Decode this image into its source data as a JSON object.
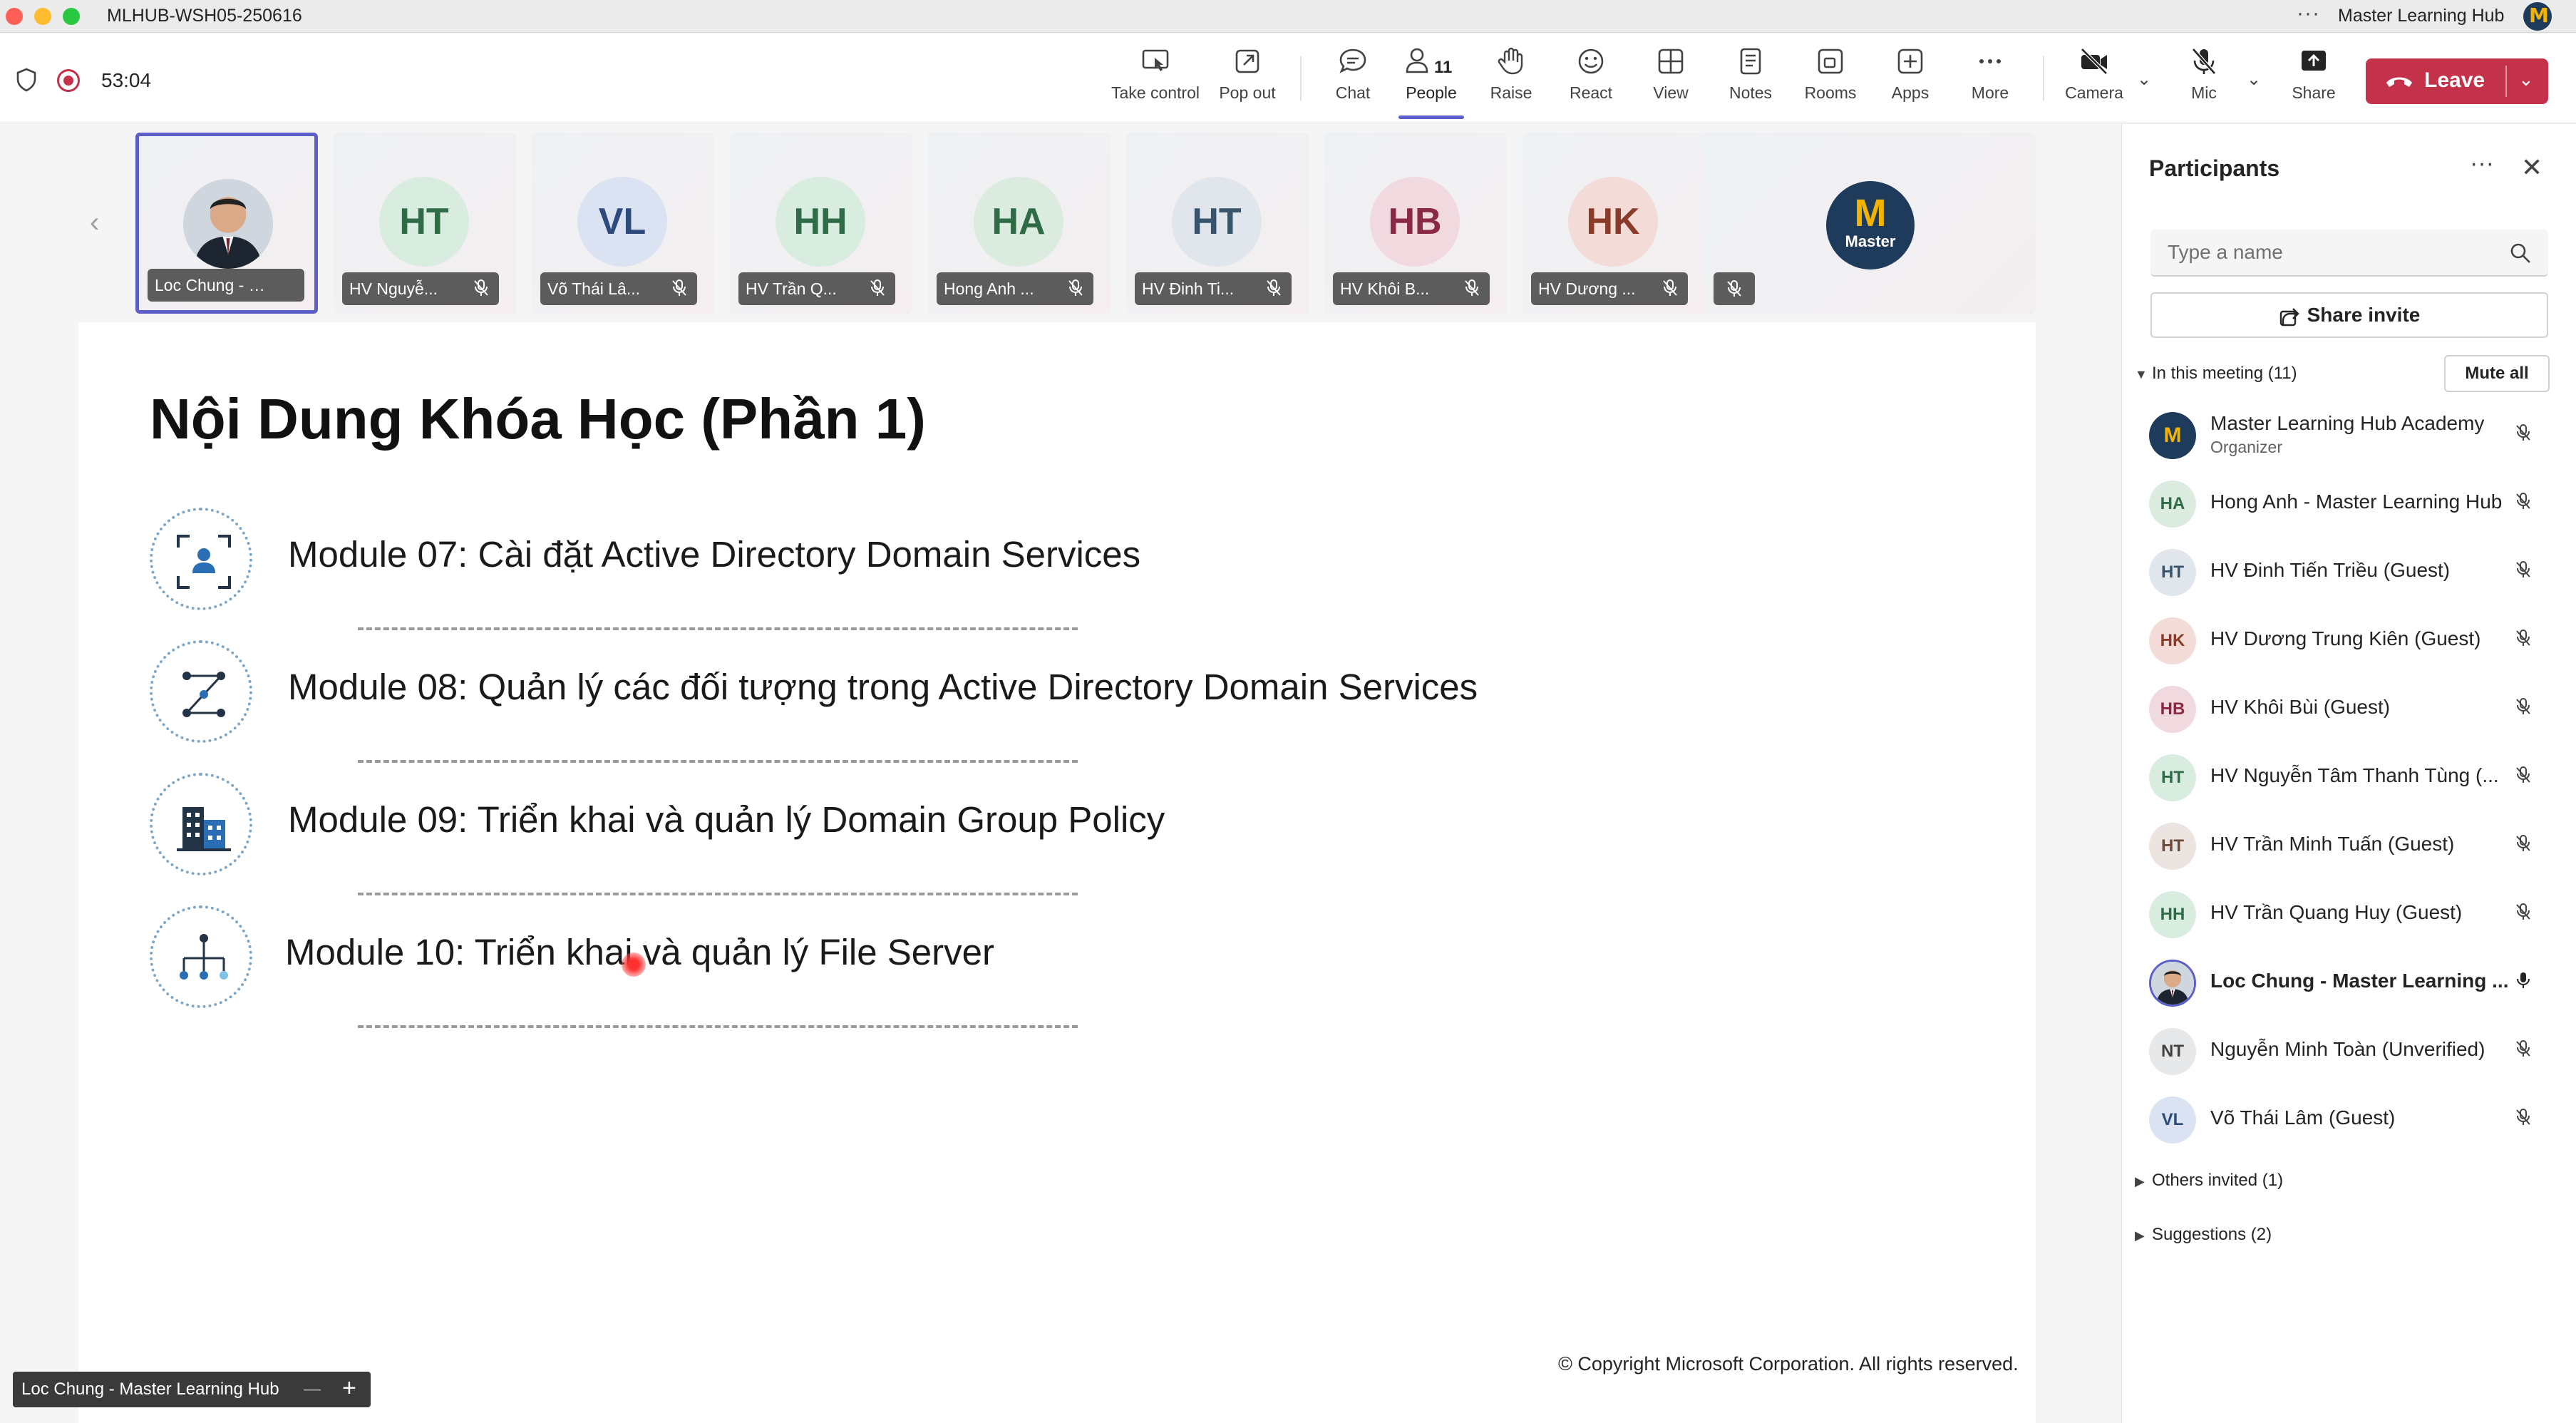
{
  "window": {
    "title": "MLHUB-WSH05-250616",
    "account_name": "Master Learning Hub"
  },
  "toolbar": {
    "timer": "53:04",
    "items": [
      {
        "label": "Take control",
        "icon": "take-control-icon"
      },
      {
        "label": "Pop out",
        "icon": "pop-out-icon"
      },
      {
        "label": "Chat",
        "icon": "chat-icon"
      },
      {
        "label": "People",
        "icon": "people-icon",
        "count": "11",
        "active": true
      },
      {
        "label": "Raise",
        "icon": "raise-hand-icon"
      },
      {
        "label": "React",
        "icon": "react-icon"
      },
      {
        "label": "View",
        "icon": "view-icon"
      },
      {
        "label": "Notes",
        "icon": "notes-icon"
      },
      {
        "label": "Rooms",
        "icon": "rooms-icon"
      },
      {
        "label": "Apps",
        "icon": "apps-icon"
      },
      {
        "label": "More",
        "icon": "more-icon"
      },
      {
        "label": "Camera",
        "icon": "camera-off-icon"
      },
      {
        "label": "Mic",
        "icon": "mic-off-icon"
      },
      {
        "label": "Share",
        "icon": "share-icon"
      }
    ],
    "leave_label": "Leave"
  },
  "video_strip": {
    "tiles": [
      {
        "initials": "",
        "name": "Loc Chung - M...",
        "photo": true,
        "selected": true,
        "muted": false
      },
      {
        "initials": "HT",
        "name": "HV Nguyễ...",
        "bg": "#d8ede0",
        "fg": "#2e6b46",
        "muted": true
      },
      {
        "initials": "VL",
        "name": "Võ Thái Lâ...",
        "bg": "#dbe3f2",
        "fg": "#2c4a7c",
        "muted": true
      },
      {
        "initials": "HH",
        "name": "HV Trần Q...",
        "bg": "#d8ede0",
        "fg": "#2e6b46",
        "muted": true
      },
      {
        "initials": "HA",
        "name": "Hong Anh ...",
        "bg": "#dcebe0",
        "fg": "#2e6b46",
        "muted": true
      },
      {
        "initials": "HT",
        "name": "HV Đinh Ti...",
        "bg": "#e0e6ec",
        "fg": "#37546b",
        "muted": true
      },
      {
        "initials": "HB",
        "name": "HV Khôi B...",
        "bg": "#f1d9e0",
        "fg": "#8a2945",
        "muted": true
      },
      {
        "initials": "HK",
        "name": "HV Dương ...",
        "bg": "#f3dcd7",
        "fg": "#8a3b2a",
        "muted": true
      }
    ],
    "logo_tile": {
      "logo_letter": "M",
      "logo_word": "Master"
    }
  },
  "slide": {
    "title": "Nội Dung Khóa Học (Phần 1)",
    "modules": [
      {
        "text": "Module 07: Cài đặt Active Directory Domain Services",
        "icon": "user-focus-icon"
      },
      {
        "text": "Module 08: Quản lý các đối tượng trong Active Directory Domain Services",
        "icon": "network-nodes-icon"
      },
      {
        "text": "Module 09: Triển khai và quản lý Domain Group Policy",
        "icon": "building-icon"
      },
      {
        "text": "Module 10: Triển khai và quản lý File Server",
        "icon": "hierarchy-icon"
      }
    ],
    "copyright": "© Copyright Microsoft Corporation. All rights reserved."
  },
  "speaker_label": "Loc Chung - Master Learning Hub",
  "participants": {
    "title": "Participants",
    "search_placeholder": "Type a name",
    "share_invite": "Share invite",
    "in_meeting_label": "In this meeting (11)",
    "mute_all": "Mute all",
    "people": [
      {
        "initials": "M",
        "name": "Master Learning Hub Academy",
        "role": "Organizer",
        "logo": true,
        "mic": "off"
      },
      {
        "initials": "HA",
        "name": "Hong Anh - Master Learning Hub",
        "bg": "#dcebe0",
        "fg": "#2e6b46",
        "mic": "off"
      },
      {
        "initials": "HT",
        "name": "HV Đinh Tiến Triều (Guest)",
        "bg": "#e0e6ec",
        "fg": "#37546b",
        "mic": "off"
      },
      {
        "initials": "HK",
        "name": "HV Dương Trung Kiên (Guest)",
        "bg": "#f3dcd7",
        "fg": "#8a3b2a",
        "mic": "off"
      },
      {
        "initials": "HB",
        "name": "HV Khôi Bùi (Guest)",
        "bg": "#f1d9e0",
        "fg": "#8a2945",
        "mic": "off"
      },
      {
        "initials": "HT",
        "name": "HV Nguyễn Tâm Thanh Tùng (...",
        "bg": "#d8ede0",
        "fg": "#2e6b46",
        "mic": "off"
      },
      {
        "initials": "HT",
        "name": "HV Trần Minh Tuấn (Guest)",
        "bg": "#ece4e0",
        "fg": "#6b4a37",
        "mic": "off"
      },
      {
        "initials": "HH",
        "name": "HV Trần Quang Huy (Guest)",
        "bg": "#d8ede0",
        "fg": "#2e6b46",
        "mic": "off"
      },
      {
        "initials": "",
        "name": "Loc Chung - Master Learning ...",
        "photo": true,
        "bold": true,
        "mic": "on"
      },
      {
        "initials": "NT",
        "name": "Nguyễn Minh Toàn (Unverified)",
        "bg": "#e6e8ea",
        "fg": "#424242",
        "mic": "off"
      },
      {
        "initials": "VL",
        "name": "Võ Thái Lâm (Guest)",
        "bg": "#dbe3f2",
        "fg": "#2c4a7c",
        "mic": "off"
      }
    ],
    "others_invited": "Others invited (1)",
    "suggestions": "Suggestions (2)"
  }
}
